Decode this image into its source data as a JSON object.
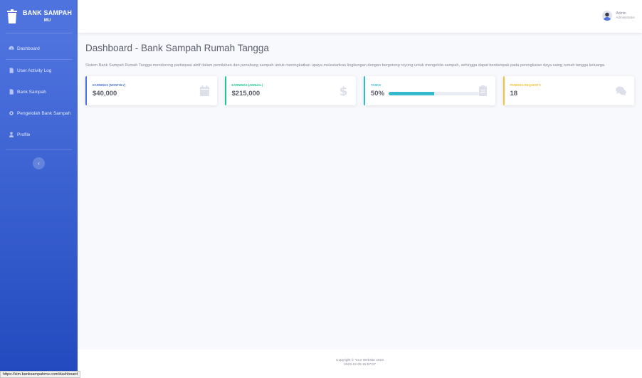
{
  "brand": {
    "title": "BANK SAMPAH",
    "subtitle": "MU"
  },
  "sidebar": {
    "items": [
      {
        "label": "Dashboard",
        "icon": "dashboard-icon"
      },
      {
        "label": "User Activity Log",
        "icon": "file-icon"
      },
      {
        "label": "Bank Sampah",
        "icon": "file-icon"
      },
      {
        "label": "Pengelolah Bank Sampah",
        "icon": "settings-icon"
      },
      {
        "label": "Profile",
        "icon": "user-icon"
      }
    ],
    "toggle_label": "‹"
  },
  "topbar": {
    "user_name": "Admin",
    "user_role": "Administrator"
  },
  "main": {
    "title": "Dashboard - Bank Sampah Rumah Tangga",
    "description": "Sistem Bank Sampah Rumah Tangga mendorong partisipasi aktif dalam pemilahan dan penabung sampah untuk meningkatkan upaya melestarikan lingkungan dengan bergotong royong untuk mengelola sampah, sehingga dapat berdampak pada peningkatan daya saing rumah tangga keluarga.",
    "cards": [
      {
        "label": "EARNINGS (MONTHLY)",
        "value": "$40,000",
        "color": "#4e73df",
        "icon": "calendar-icon"
      },
      {
        "label": "EARNINGS (ANNUAL)",
        "value": "$215,000",
        "color": "#1cc88a",
        "icon": "dollar-icon"
      },
      {
        "label": "TASKS",
        "value": "50%",
        "color": "#36b9cc",
        "icon": "clipboard-icon",
        "progress": 0.5
      },
      {
        "label": "PENDING REQUESTS",
        "value": "18",
        "color": "#f6c23e",
        "icon": "comments-icon"
      }
    ]
  },
  "footer": {
    "copyright": "Copyright © Your Website 2023",
    "timestamp": "2023-12-05 15:57:07"
  },
  "statusbar": {
    "url": "https://sim.banksampahmu.com/dashboard"
  }
}
